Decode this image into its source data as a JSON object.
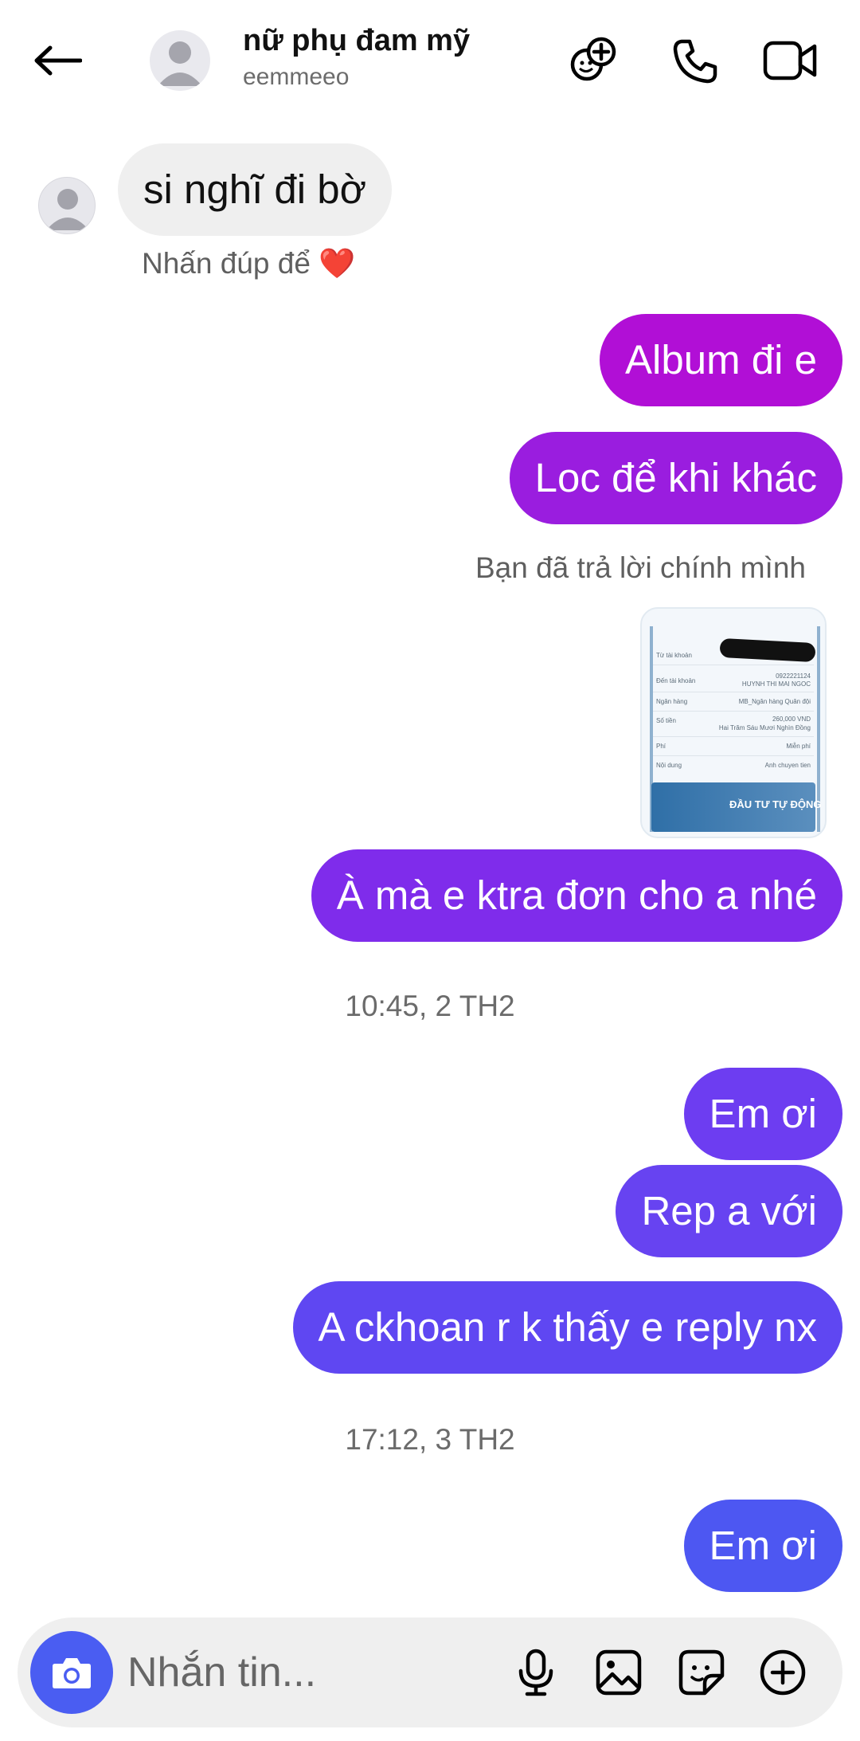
{
  "header": {
    "name": "nữ phụ đam mỹ",
    "username": "eemmeeo",
    "icons": [
      "back-arrow-icon",
      "avatar",
      "add-people-icon",
      "phone-icon",
      "video-camera-icon"
    ]
  },
  "messages": {
    "incoming_1": "si nghĩ đi bờ",
    "double_tap_hint": "Nhấn đúp để ❤️",
    "out_1": "Album đi e",
    "out_2": "Loc để khi khác",
    "reply_caption": "Bạn đã trả lời chính mình",
    "out_3": "À mà e ktra đơn cho a nhé",
    "time_1": "10:45, 2 TH2",
    "out_4": "Em ơi",
    "out_5": "Rep a với",
    "out_6": "A ckhoan r k thấy e reply nx",
    "time_2": "17:12, 3 TH2",
    "out_7": "Em ơi"
  },
  "receipt": {
    "to_account_label": "Từ tài khoản",
    "to_label": "Đến tài khoản",
    "account_no": "0922221124",
    "recipient": "HUYNH THI MAI NGOC",
    "bank_label": "Ngân hàng",
    "bank": "MB_Ngân hàng Quân đội",
    "amount_label": "Số tiền",
    "amount": "260,000 VND",
    "amount_words": "Hai Trăm Sáu Mươi Nghìn Đồng",
    "fee_label": "Phí",
    "fee": "Miễn phí",
    "content_label": "Nội dung",
    "content": "Anh chuyen tien",
    "ad_text": "ĐẦU TƯ TỰ ĐỘNG"
  },
  "composer": {
    "placeholder": "Nhắn tin..."
  },
  "colors": {
    "bubble_magenta": "#b10fd6",
    "bubble_violet_1": "#8b23e8",
    "bubble_violet_2": "#6e3cf2",
    "bubble_blue": "#5b4ef3",
    "bubble_blue_last": "#4d57f2",
    "camera_button": "#4a5df2",
    "incoming_bubble": "#efefef"
  }
}
